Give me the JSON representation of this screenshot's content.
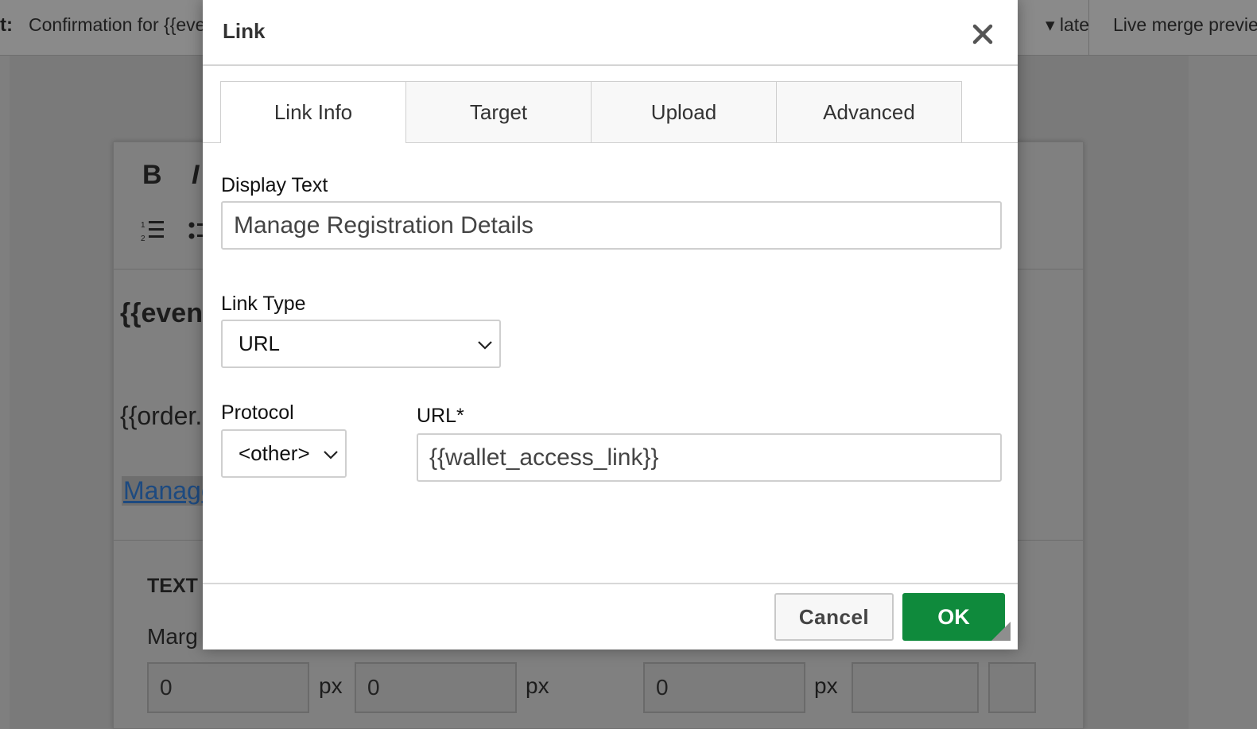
{
  "background": {
    "subject_label": "t:",
    "subject_value": "Confirmation for {{event",
    "template_menu": "late ▾",
    "live_merge": "Live merge preview",
    "toolbar": {
      "bold": "B",
      "italic": "I"
    },
    "content": {
      "event_line": "{{event",
      "order_line": "{{order.",
      "manage_link": "Manage"
    },
    "text_section": {
      "heading": "TEXT",
      "margin_label": "Marg",
      "inputs": [
        "0",
        "0",
        "0",
        ""
      ],
      "unit": "px"
    }
  },
  "dialog": {
    "title": "Link",
    "tabs": [
      {
        "label": "Link Info",
        "active": true
      },
      {
        "label": "Target",
        "active": false
      },
      {
        "label": "Upload",
        "active": false
      },
      {
        "label": "Advanced",
        "active": false
      }
    ],
    "display_text": {
      "label": "Display Text",
      "value": "Manage Registration Details"
    },
    "link_type": {
      "label": "Link Type",
      "selected": "URL"
    },
    "protocol": {
      "label": "Protocol",
      "selected": "<other>"
    },
    "url": {
      "label": "URL*",
      "value": "{{wallet_access_link}}"
    },
    "buttons": {
      "cancel": "Cancel",
      "ok": "OK"
    }
  },
  "colors": {
    "ok_button": "#0f8a3c",
    "overlay": "#7f7f7f",
    "link_color": "#1d4a80"
  }
}
